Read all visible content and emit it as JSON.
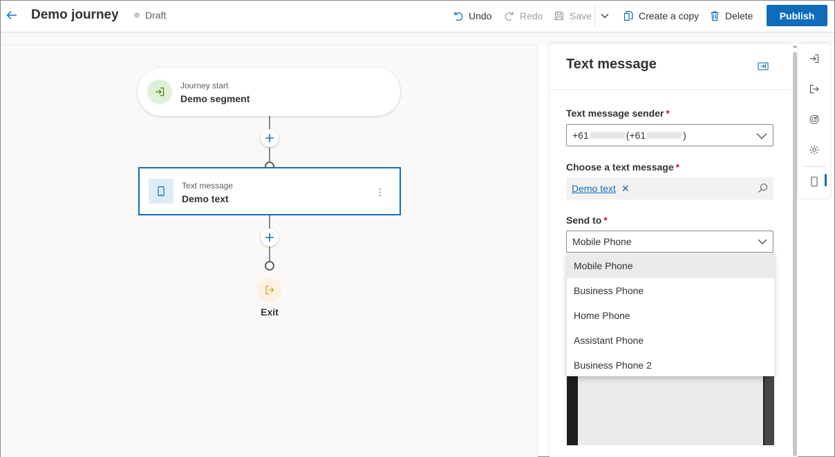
{
  "header": {
    "title": "Demo journey",
    "status": "Draft",
    "undo_label": "Undo",
    "redo_label": "Redo",
    "save_label": "Save",
    "create_copy_label": "Create a copy",
    "delete_label": "Delete",
    "publish_label": "Publish"
  },
  "canvas": {
    "start_node": {
      "label": "Journey start",
      "value": "Demo segment"
    },
    "text_node": {
      "label": "Text message",
      "value": "Demo text",
      "more": "⋮"
    },
    "exit_label": "Exit"
  },
  "panel": {
    "title": "Text message",
    "sender": {
      "label": "Text message sender",
      "required": "*",
      "value_prefix": "+61",
      "value_mid": " (+61",
      "value_suffix": ")"
    },
    "message": {
      "label": "Choose a text message",
      "required": "*",
      "tag": "Demo text",
      "tag_remove": "✕"
    },
    "send_to": {
      "label": "Send to",
      "required": "*",
      "value": "Mobile Phone",
      "options": [
        "Mobile Phone",
        "Business Phone",
        "Home Phone",
        "Assistant Phone",
        "Business Phone 2"
      ],
      "selected_index": 0
    }
  },
  "colors": {
    "accent": "#0f6cbd",
    "start_node_icon_bg": "#dff0d8",
    "exit_icon_bg": "#fdf1e1",
    "required": "#a4262c"
  },
  "icons": {
    "back": "arrow-left-icon",
    "undo": "undo-icon",
    "redo": "redo-icon",
    "save": "save-icon",
    "more_commands": "chevron-down-icon",
    "copy": "copy-icon",
    "delete": "trash-icon",
    "start": "sign-in-icon",
    "text_message": "phone-icon",
    "add": "plus-icon",
    "exit": "sign-out-icon",
    "collapse": "collapse-panel-icon",
    "search": "search-icon",
    "rail": [
      "enter-icon",
      "exit-icon",
      "target-icon",
      "gear-icon",
      "phone-icon"
    ]
  }
}
